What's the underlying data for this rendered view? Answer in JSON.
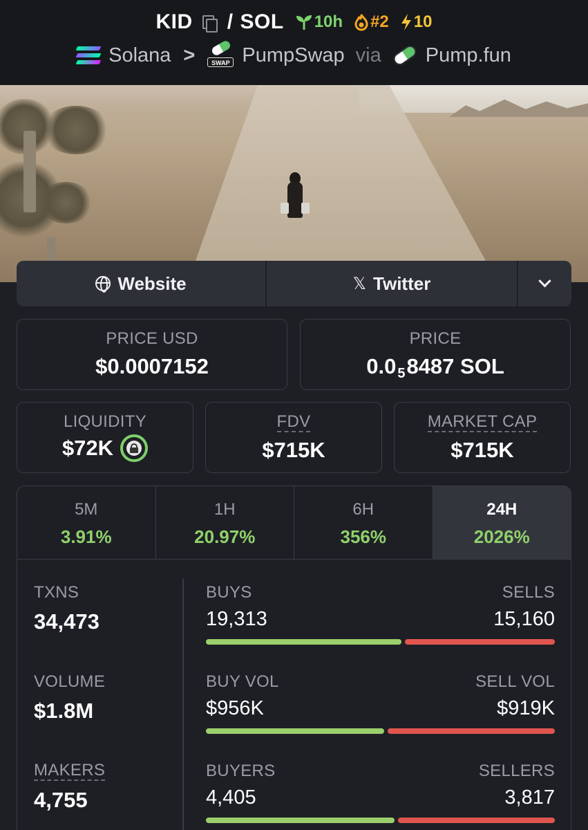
{
  "header": {
    "base_symbol": "KID",
    "separator": "/",
    "quote_symbol": "SOL",
    "age": "10h",
    "trending_rank": "#2",
    "boosts": "10",
    "chain": "Solana",
    "dex": "PumpSwap",
    "via_label": "via",
    "launchpad": "Pump.fun",
    "swap_badge": "SWAP"
  },
  "links": {
    "website_label": "Website",
    "twitter_label": "Twitter"
  },
  "prices": {
    "price_usd_label": "PRICE USD",
    "price_usd": "$0.0007152",
    "price_label": "PRICE",
    "price_native_prefix": "0.0",
    "price_native_zeros": "5",
    "price_native_rest": "8487 SOL"
  },
  "metrics": {
    "liquidity_label": "LIQUIDITY",
    "liquidity": "$72K",
    "fdv_label": "FDV",
    "fdv": "$715K",
    "mcap_label": "MARKET CAP",
    "mcap": "$715K"
  },
  "timeframes": [
    {
      "label": "5M",
      "change": "3.91%",
      "active": false
    },
    {
      "label": "1H",
      "change": "20.97%",
      "active": false
    },
    {
      "label": "6H",
      "change": "356%",
      "active": false
    },
    {
      "label": "24H",
      "change": "2026%",
      "active": true
    }
  ],
  "stats": {
    "txns_label": "TXNS",
    "txns": "34,473",
    "volume_label": "VOLUME",
    "volume": "$1.8M",
    "makers_label": "MAKERS",
    "makers": "4,755",
    "buys_label": "BUYS",
    "buys": "19,313",
    "sells_label": "SELLS",
    "sells": "15,160",
    "buys_fraction": 0.56,
    "buy_vol_label": "BUY VOL",
    "buy_vol": "$956K",
    "sell_vol_label": "SELL VOL",
    "sell_vol": "$919K",
    "buy_vol_fraction": 0.51,
    "buyers_label": "BUYERS",
    "buyers": "4,405",
    "sellers_label": "SELLERS",
    "sellers": "3,817",
    "buyers_fraction": 0.54
  },
  "colors": {
    "positive": "#8fd16a",
    "buy_bar": "#9bcf6c",
    "sell_bar": "#e0564f",
    "background": "#1e1f25"
  }
}
